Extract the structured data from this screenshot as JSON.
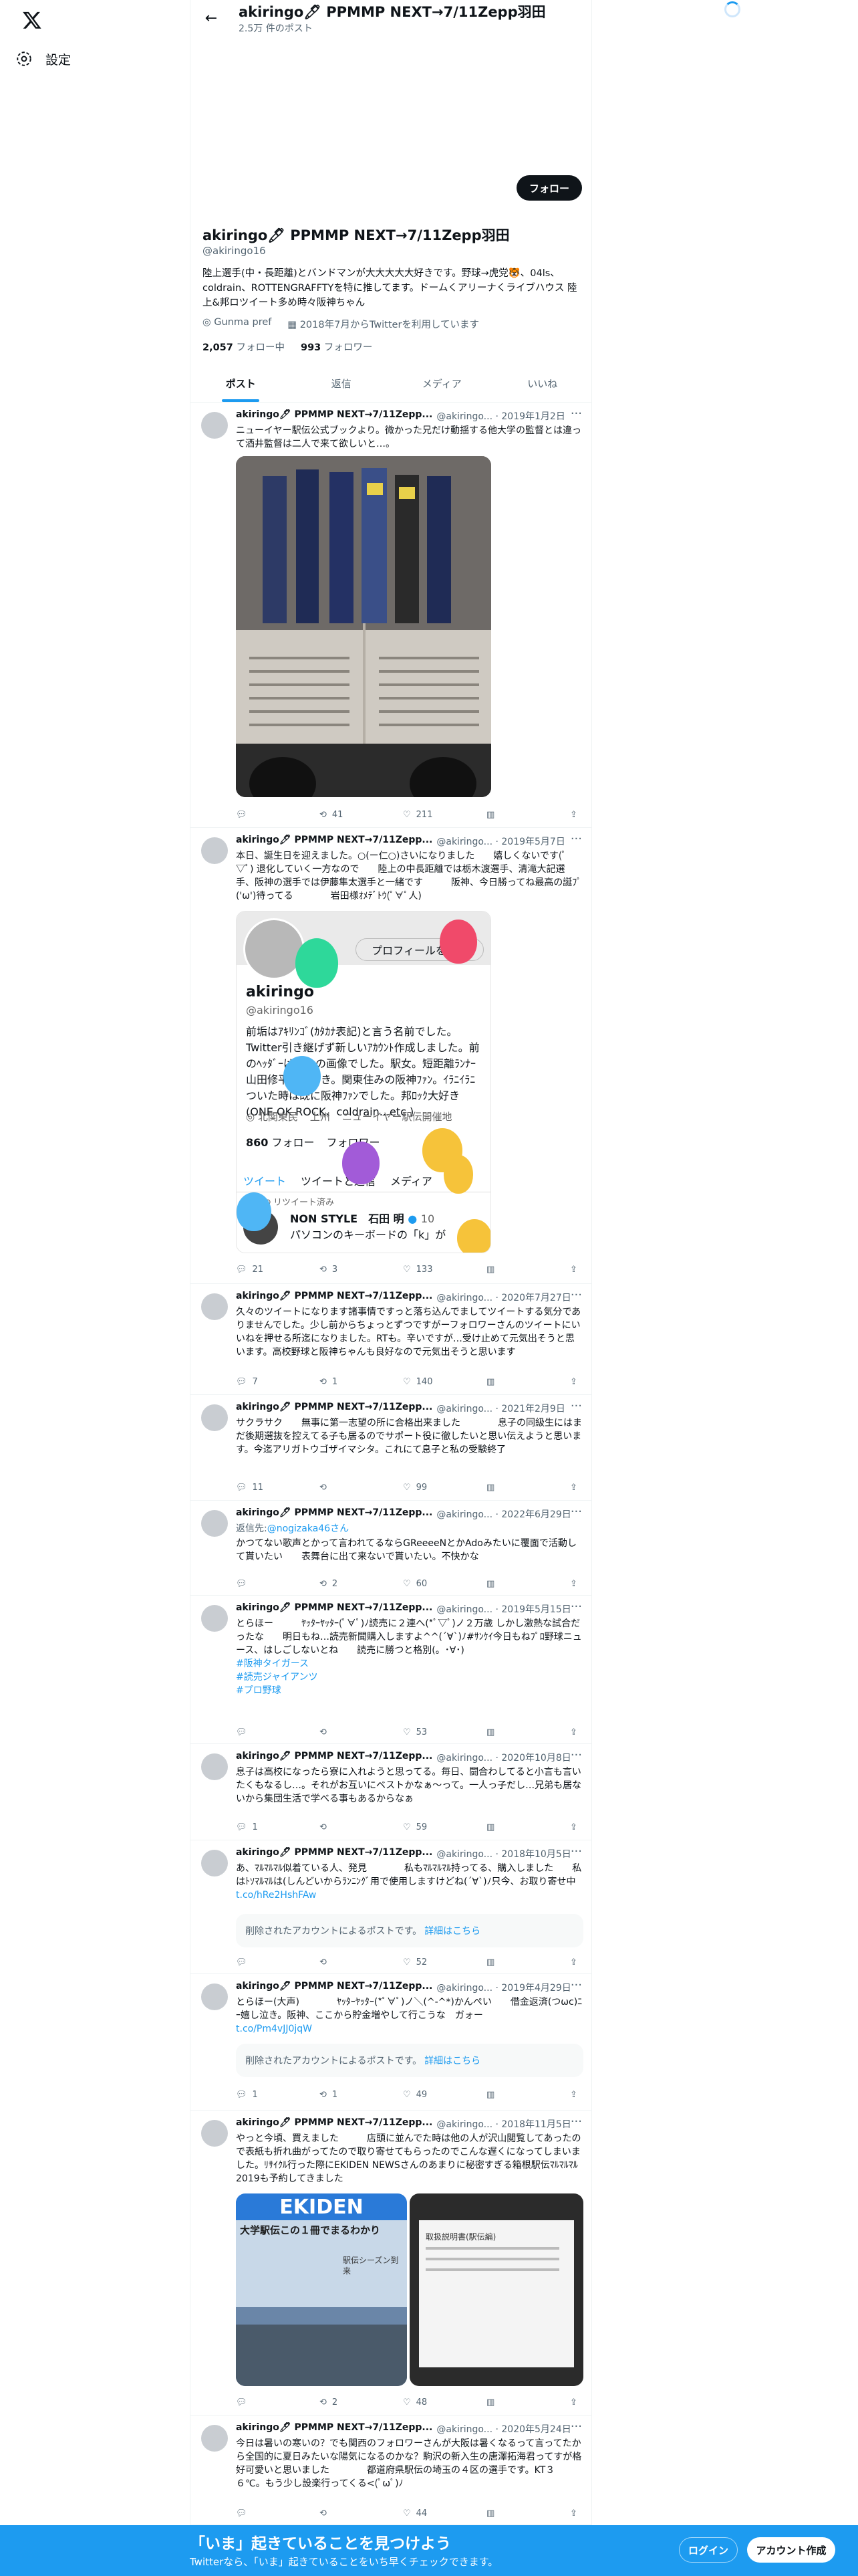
{
  "nav": {
    "settings_label": "設定"
  },
  "header": {
    "title": "akiringo🖊 PPMMP NEXT→7/11Zepp羽田",
    "post_count": "2.5万 件のポスト"
  },
  "profile": {
    "follow_label": "フォロー",
    "name": "akiringo🖊 PPMMP NEXT→7/11Zepp羽田",
    "handle": "@akiringo16",
    "bio": "陸上選手(中・長距離)とバンドマンが大大大大大好きです。野球→虎党🐯、04ls、coldrain、ROTTENGRAFFTYを特に推してます。ドームくアリーナくライブハウス 陸上&邦ロツイート多め時々阪神ちゃん",
    "location": "Gunma pref",
    "joined": "2018年7月からTwitterを利用しています",
    "following_count": "2,057",
    "following_label": "フォロー中",
    "followers_count": "993",
    "followers_label": "フォロワー"
  },
  "tabs": [
    {
      "label": "ポスト"
    },
    {
      "label": "返信"
    },
    {
      "label": "メディア"
    },
    {
      "label": "いいね"
    }
  ],
  "tweets": [
    {
      "name": "akiringo🖊 PPMMP NEXT→7/11Zepp...",
      "meta": "@akiringo... · 2019年1月2日",
      "text": "ニューイヤー駅伝公式ブックより。微かった兄だけ動揺する他大学の監督とは違って酒井監督は二人で来て欲しいと…。",
      "reply": "",
      "retweet": "41",
      "like": "211"
    },
    {
      "name": "akiringo🖊 PPMMP NEXT→7/11Zepp...",
      "meta": "@akiringo... · 2019年5月7日",
      "text": "本日、誕生日を迎えました。○(ー仁○)さいになりました　　嬉しくないです(ﾟ▽ﾟ) 退化していく一方なので　　陸上の中長距離では栃木渡選手、清滝大記選手、阪神の選手では伊藤隼太選手と一緒です　　　阪神、今日勝ってね最高の誕ﾌﾟ('ω')待ってる　　　　岩田様ｵﾒﾃﾞﾄｳ(ﾟ∀ﾟ人)",
      "reply": "21",
      "retweet": "3",
      "like": "133"
    },
    {
      "name": "akiringo🖊 PPMMP NEXT→7/11Zepp...",
      "meta": "@akiringo... · 2020年7月27日",
      "text": "久々のツイートになります諸事情ですっと落ち込んでましてツイートする気分でありませんでした。少し前からちょっとずつですがーフォロワーさんのツイートにいいねを押せる所迄になりました。RTも。辛いですが…受け止めて元気出そうと思います。高校野球と阪神ちゃんも良好なので元気出そうと思います",
      "reply": "7",
      "retweet": "1",
      "like": "140"
    },
    {
      "name": "akiringo🖊 PPMMP NEXT→7/11Zepp...",
      "meta": "@akiringo... · 2021年2月9日",
      "text": "サクラサク　　無事に第一志望の所に合格出来ました　　　　息子の同級生にはまだ後期選抜を控えてる子も居るのでサポート役に徹したいと思い伝えようと思います。今迄アリガトウゴザイマシタ。これにて息子と私の受験終了",
      "reply": "11",
      "retweet": "",
      "like": "99"
    },
    {
      "name": "akiringo🖊 PPMMP NEXT→7/11Zepp...",
      "meta": "@akiringo... · 2022年6月29日",
      "reply_to": "返信先:",
      "reply_to_link": "@nogizaka46さん",
      "text": "かつてない歌声とかって言われてるならGReeeeNとかAdoみたいに覆面で活動して貰いたい　　表舞台に出て来ないで貰いたい。不快かな",
      "reply": "",
      "retweet": "2",
      "like": "60"
    },
    {
      "name": "akiringo🖊 PPMMP NEXT→7/11Zepp...",
      "meta": "@akiringo... · 2019年5月15日",
      "text": "とらほー　　　ﾔｯﾀｰﾔｯﾀｰ(ﾟ∀ﾟ)ﾉ読売に２連へ(*ﾟ▽ﾟ)ノ２万歳 しかし激熱な試合だったな　　明日もね…読売新聞購入しますよ^^(´∀`)ﾉ#ｻﾝｹｲ今日もねﾌﾟﾛ野球ニュース、はしごしないとね　　読売に勝つと格別(。･∀･)",
      "hashtags": [
        "#阪神タイガース",
        "#読売ジャイアンツ",
        "#プロ野球"
      ],
      "reply": "",
      "retweet": "",
      "like": "53"
    },
    {
      "name": "akiringo🖊 PPMMP NEXT→7/11Zepp...",
      "meta": "@akiringo... · 2020年10月8日",
      "text": "息子は高校になったら寮に入れようと思ってる。毎日、闘合わしてると小言も言いたくもなるし…。それがお互いにベストかなぁ～って。一人っ子だし…兄弟も居ないから集団生活で学べる事もあるからなぁ",
      "reply": "1",
      "retweet": "",
      "like": "59"
    },
    {
      "name": "akiringo🖊 PPMMP NEXT→7/11Zepp...",
      "meta": "@akiringo... · 2018年10月5日",
      "text": "あ、ﾏﾙﾏﾙﾏﾙ似着ている人、発見　　　　私もﾏﾙﾏﾙﾏﾙ持ってる、購入しました　　私はﾄｿﾏﾙﾏﾙは(しんどいからﾗﾝﾆﾝｸﾞ用で使用しますけどね(´∀`)ﾉ只今、お取り寄せ中",
      "link": "t.co/hRe2HshFAw",
      "deleted_label": "削除されたアカウントによるポストです。",
      "deleted_link": "詳細はこちら",
      "reply": "",
      "retweet": "",
      "like": "52"
    },
    {
      "name": "akiringo🖊 PPMMP NEXT→7/11Zepp...",
      "meta": "@akiringo... · 2019年4月29日",
      "text": "とらほー(大声)　　　　ﾔｯﾀｰﾔｯﾀｰ(*ﾟ∀ﾟ)ノ＼(^-^*)かんぺい　　借金返済(つωc)ﾆｰ嬉し泣き。阪神、ここから貯金増やして行こうな　ガォー",
      "link": "t.co/Pm4vJJ0jqW",
      "deleted_label": "削除されたアカウントによるポストです。",
      "deleted_link": "詳細はこちら",
      "reply": "1",
      "retweet": "1",
      "like": "49"
    },
    {
      "name": "akiringo🖊 PPMMP NEXT→7/11Zepp...",
      "meta": "@akiringo... · 2018年11月5日",
      "text": "やっと今頃、買えました　　　店頭に並んでた時は他の人が沢山閲覧してあったので表紙も折れ曲がってたので取り寄せてもらったのでこんな遅くになってしまいました。ﾘｻｲｸﾙ行った際にEKIDEN NEWSさんのあまりに秘密すぎる箱根駅伝ﾏﾙﾏﾙﾏﾙ2019も予約してきました",
      "reply": "",
      "retweet": "2",
      "like": "48"
    },
    {
      "name": "akiringo🖊 PPMMP NEXT→7/11Zepp...",
      "meta": "@akiringo... · 2020年5月24日",
      "text": "今日は暑いの寒いの？でも関西のフォロワーさんが大阪は暑くなるって言ってたから全国的に夏日みたいな陽気になるのかな？駒沢の新入生の唐澤拓海君ってすが格好可愛いと思いました　　　　都道府県駅伝の埼玉の４区の選手です。KT３６℃。もう少し設楽行ってくる<(ﾟωﾟ)ﾉ",
      "reply": "",
      "retweet": "",
      "like": "44"
    }
  ],
  "embedded_profile": {
    "name": "akiringo",
    "handle": "@akiringo16",
    "button": "プロフィールを編集",
    "bio": "前垢はｱｷﾘﾝｺﾞ(ｶﾀｶﾅ表記)と言う名前でした。Twitter引き継げず新しいｱｶｳﾝﾄ作成しました。前のﾍｯﾀﾞｰはｲｹﾒﾝの画像でした。駅女。短距離ﾗﾝﾅｰ山田修平君が好き。関東住みの阪神ﾌｧﾝ。ｲﾗﾆｲﾗﾆついた時は既に阪神ﾌｧﾝでした。邦ﾛｯｸ大好き(ONE OK ROCK、coldrain...etc.)",
    "location": "北関東民",
    "place": "上州",
    "event": "ニューイヤー駅伝開催地",
    "following": "860",
    "following_label": "フォロー",
    "followers_label": "フォロワー",
    "tab1": "ツイート",
    "tab2": "ツイートと返信",
    "tab3": "メディア",
    "retweeted": "リツイート済み",
    "rt_name": "NON STYLE　石田 明",
    "rt_time": "10",
    "rt_text": "パソコンのキーボードの「k」が"
  },
  "book_cover": {
    "title": "EKIDEN",
    "subtitle": "大学駅伝この１冊でまるわかり",
    "caption": "駅伝シーズン到来",
    "doc": "取扱説明書(駅伝編)"
  },
  "bottom_bar": {
    "title": "「いま」起きていることを見つけよう",
    "subtitle": "Twitterなら、「いま」起きていることをいち早くチェックできます。",
    "login": "ログイン",
    "signup": "アカウント作成"
  }
}
